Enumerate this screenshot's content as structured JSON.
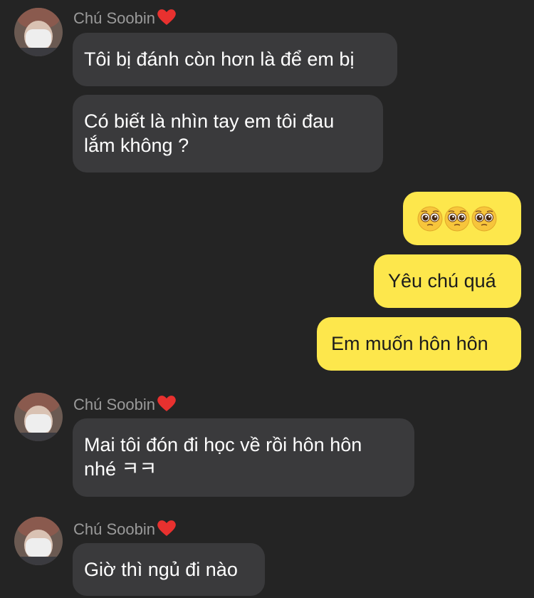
{
  "chat": {
    "sender_name": "Chú Soobin",
    "sender_heart": "heart-emoji",
    "groups": [
      {
        "sender": "Chú Soobin",
        "messages": [
          {
            "lines": [
              "Tôi bị đánh còn hơn là để em bị"
            ]
          },
          {
            "lines": [
              "Có biết là nhìn tay em tôi đau",
              "lắm không ?"
            ]
          }
        ]
      },
      {
        "sender": "me",
        "messages": [
          {
            "emoji": [
              "pleading-face",
              "pleading-face",
              "pleading-face"
            ]
          },
          {
            "lines": [
              "Yêu chú quá"
            ]
          },
          {
            "lines": [
              "Em muốn hôn hôn"
            ]
          }
        ]
      },
      {
        "sender": "Chú Soobin",
        "messages": [
          {
            "lines": [
              "Mai tôi đón đi học về rồi hôn hôn",
              "nhé ㅋㅋ"
            ]
          }
        ]
      },
      {
        "sender": "Chú Soobin",
        "messages": [
          {
            "lines": [
              "Giờ thì ngủ đi nào"
            ]
          }
        ]
      }
    ]
  },
  "colors": {
    "background": "#242424",
    "incoming_bubble": "#3a3a3c",
    "outgoing_bubble": "#fde74c",
    "sender_name": "#9a9a9a"
  }
}
